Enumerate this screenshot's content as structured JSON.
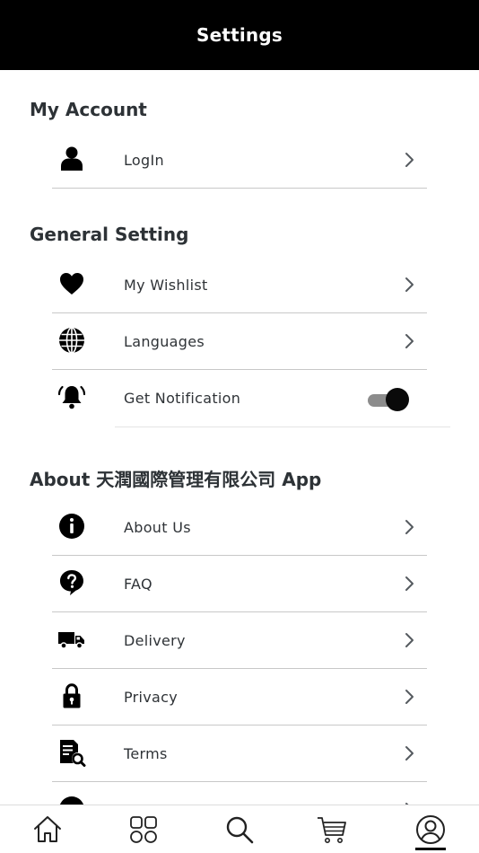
{
  "header": {
    "title": "Settings"
  },
  "sections": {
    "account": {
      "title": "My Account",
      "items": [
        {
          "label": "LogIn",
          "icon": "user-icon"
        }
      ]
    },
    "general": {
      "title": "General Setting",
      "items": [
        {
          "label": "My Wishlist",
          "icon": "heart-icon"
        },
        {
          "label": "Languages",
          "icon": "globe-icon"
        },
        {
          "label": "Get Notification",
          "icon": "bell-icon",
          "toggle_on": true
        }
      ]
    },
    "about": {
      "title": "About 天潤國際管理有限公司 App",
      "items": [
        {
          "label": "About Us",
          "icon": "info-icon"
        },
        {
          "label": "FAQ",
          "icon": "question-bubble-icon"
        },
        {
          "label": "Delivery",
          "icon": "truck-icon"
        },
        {
          "label": "Privacy",
          "icon": "lock-icon"
        },
        {
          "label": "Terms",
          "icon": "document-search-icon"
        }
      ]
    }
  },
  "tabbar": {
    "items": [
      {
        "icon": "home-icon"
      },
      {
        "icon": "categories-grid-icon"
      },
      {
        "icon": "search-icon"
      },
      {
        "icon": "cart-icon"
      },
      {
        "icon": "profile-icon",
        "active": true
      }
    ]
  },
  "colors": {
    "header_bg": "#000000",
    "text": "#2b2f33",
    "divider": "#c8c8c8",
    "toggle_track": "#8c8c8c",
    "toggle_knob": "#0a0a0a"
  }
}
